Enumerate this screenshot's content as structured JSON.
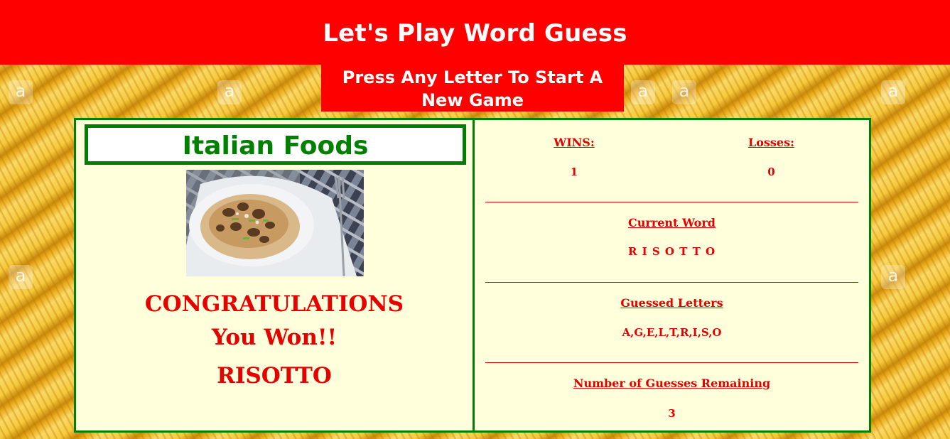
{
  "header": {
    "title": "Let's Play Word Guess"
  },
  "start_banner": {
    "text": "Press Any Letter To Start A New Game"
  },
  "category": {
    "title": "Italian Foods"
  },
  "result": {
    "line1": "CONGRATULATIONS",
    "line2": "You Won!!",
    "word": "RISOTTO"
  },
  "scoreboard": {
    "wins_label": "WINS:",
    "wins_value": "1",
    "losses_label": "Losses:",
    "losses_value": "0",
    "current_word_label": "Current Word",
    "current_word_value": "R I S O T T O",
    "guessed_label": "Guessed Letters",
    "guessed_value": "A,G,E,L,T,R,I,S,O",
    "remaining_label": "Number of Guesses Remaining",
    "remaining_value": "3"
  },
  "watermark": {
    "glyph": "a"
  },
  "colors": {
    "header_red": "#ff0000",
    "panel_bg": "#ffffdc",
    "border_green": "#008000",
    "text_red": "#e60000"
  }
}
